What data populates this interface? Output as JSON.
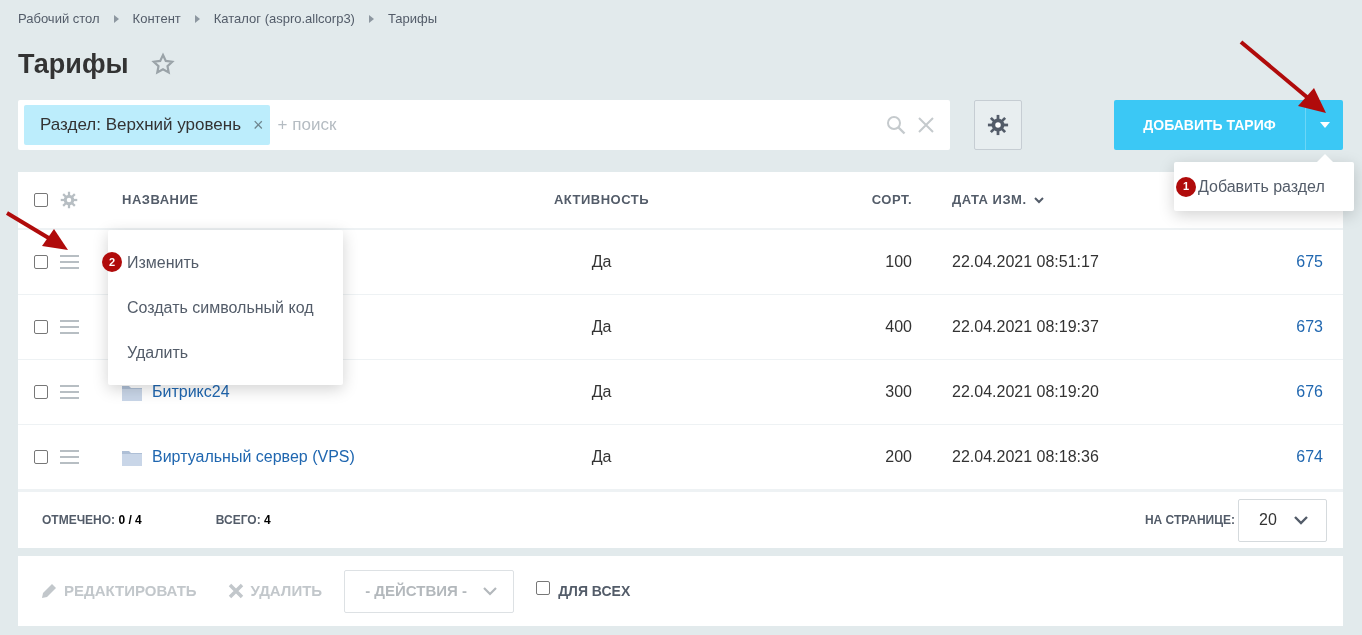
{
  "breadcrumbs": [
    "Рабочий стол",
    "Контент",
    "Каталог (aspro.allcorp3)",
    "Тарифы"
  ],
  "title": "Тарифы",
  "favorite": false,
  "filter": {
    "chip": "Раздел: Верхний уровень",
    "chip_remove": "×",
    "placeholder": "+ поиск"
  },
  "add_button": {
    "label": "ДОБАВИТЬ ТАРИФ"
  },
  "add_menu": {
    "items": [
      {
        "badge": "1",
        "label": "Добавить раздел"
      }
    ]
  },
  "table": {
    "select_all_checked": false,
    "columns": [
      {
        "label": "НАЗВАНИЕ",
        "sorted": false
      },
      {
        "label": "АКТИВНОСТЬ",
        "sorted": false
      },
      {
        "label": "СОРТ.",
        "sorted": false
      },
      {
        "label": "ДАТА ИЗМ.",
        "sorted": true
      }
    ],
    "rows": [
      {
        "checked": false,
        "active": "Да",
        "sort": "100",
        "date": "22.04.2021 08:51:17",
        "id": "675"
      },
      {
        "checked": false,
        "active": "Да",
        "sort": "400",
        "date": "22.04.2021 08:19:37",
        "id": "673"
      },
      {
        "checked": false,
        "name": "Битрикс24",
        "active": "Да",
        "sort": "300",
        "date": "22.04.2021 08:19:20",
        "id": "676"
      },
      {
        "checked": false,
        "name": "Виртуальный сервер (VPS)",
        "active": "Да",
        "sort": "200",
        "date": "22.04.2021 08:18:36",
        "id": "674"
      }
    ]
  },
  "context_menu": {
    "items": [
      {
        "badge": "2",
        "label": "Изменить"
      },
      {
        "label": "Создать символьный код"
      },
      {
        "label": "Удалить"
      }
    ]
  },
  "footer": {
    "checked_label": "ОТМЕЧЕНО:",
    "checked_value": "0 / 4",
    "total_label": "ВСЕГО:",
    "total_value": "4",
    "per_page_label": "НА СТРАНИЦЕ:",
    "per_page": "20"
  },
  "actions": {
    "edit": {
      "label": "РЕДАКТИРОВАТЬ",
      "disabled": true
    },
    "delete": {
      "label": "УДАЛИТЬ",
      "disabled": true
    },
    "select": "- ДЕЙСТВИЯ -",
    "for_all": {
      "label": "ДЛЯ ВСЕХ",
      "checked": false
    }
  }
}
